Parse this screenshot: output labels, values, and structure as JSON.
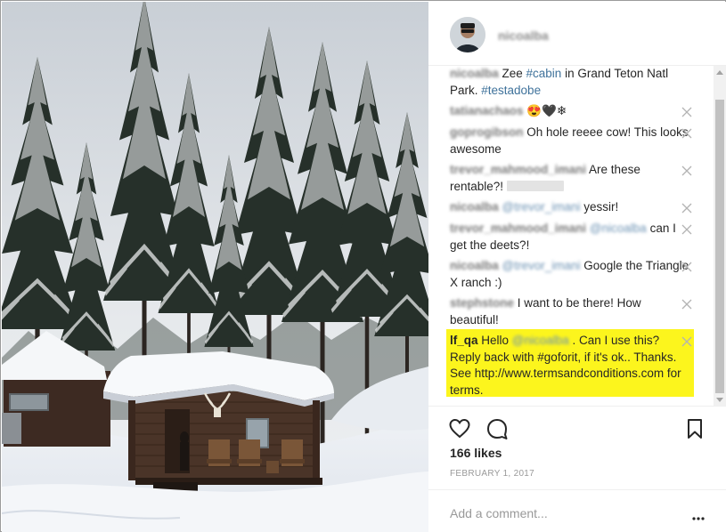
{
  "post": {
    "username": "nicoalba",
    "likes": "166 likes",
    "date": "FEBRUARY 1, 2017"
  },
  "comments": [
    {
      "user": "nicoalba",
      "segments": [
        {
          "t": " Zee ",
          "k": "text"
        },
        {
          "t": "#cabin",
          "k": "hashtag"
        },
        {
          "t": " in Grand Teton Natl Park. ",
          "k": "text"
        },
        {
          "t": "#testadobe",
          "k": "hashtag"
        }
      ],
      "deletable": false
    },
    {
      "user": "tatianachaos",
      "segments": [
        {
          "t": " 😍🖤❄",
          "k": "text"
        }
      ],
      "deletable": true
    },
    {
      "user": "goprogibson",
      "segments": [
        {
          "t": " Oh hole reeee cow! This looks awesome",
          "k": "text"
        }
      ],
      "deletable": true
    },
    {
      "user": "trevor_mahmood_imani",
      "segments": [
        {
          "t": " Are these rentable?! ",
          "k": "text"
        }
      ],
      "deletable": true
    },
    {
      "user": "nicoalba",
      "segments": [
        {
          "t": " ",
          "k": "text"
        },
        {
          "t": "@trevor_imani",
          "k": "mention"
        },
        {
          "t": " yessir!",
          "k": "text"
        }
      ],
      "deletable": true
    },
    {
      "user": "trevor_mahmood_imani",
      "segments": [
        {
          "t": " ",
          "k": "text"
        },
        {
          "t": "@nicoalba",
          "k": "mention"
        },
        {
          "t": " can I get the deets?!",
          "k": "text"
        }
      ],
      "deletable": true
    },
    {
      "user": "nicoalba",
      "segments": [
        {
          "t": " ",
          "k": "text"
        },
        {
          "t": "@trevor_imani",
          "k": "mention"
        },
        {
          "t": " Google the Triangle X ranch :)",
          "k": "text"
        }
      ],
      "deletable": true
    },
    {
      "user": "stephstone",
      "segments": [
        {
          "t": " I want to be there! How beautiful!",
          "k": "text"
        }
      ],
      "deletable": true
    }
  ],
  "highlighted_comment": {
    "user": "lf_qa",
    "pre": " Hello ",
    "mention": "@nicoalba",
    "post": " . Can I use this? Reply back with #goforit, if it's ok.. Thanks. See http://www.termsandconditions.com for terms.",
    "highlight_color": "#fcf51d"
  },
  "add_comment": {
    "placeholder": "Add a comment..."
  },
  "icons": {
    "like": "heart-outline-icon",
    "comment": "speech-bubble-icon",
    "save": "bookmark-icon",
    "more": "more-dots-icon",
    "delete": "close-x-icon"
  },
  "colors": {
    "link": "#3f729b",
    "highlight": "#fcf51d",
    "muted": "#999999"
  }
}
